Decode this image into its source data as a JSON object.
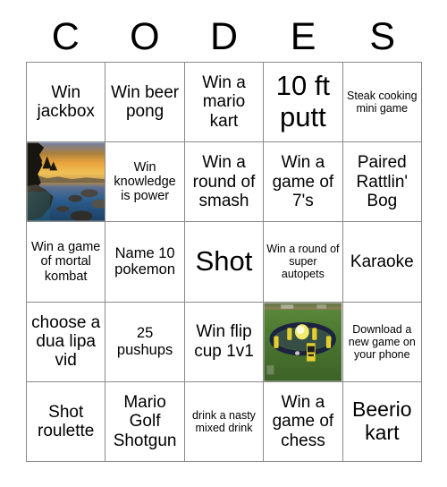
{
  "card": {
    "title_letters": [
      "C",
      "O",
      "D",
      "E",
      "S"
    ],
    "rows": [
      [
        {
          "type": "text",
          "text": "Win jackbox",
          "size": "l"
        },
        {
          "type": "text",
          "text": "Win beer pong",
          "size": "l"
        },
        {
          "type": "text",
          "text": "Win a mario kart",
          "size": "l"
        },
        {
          "type": "text",
          "text": "10 ft putt",
          "size": "xxl"
        },
        {
          "type": "text",
          "text": "Steak cooking mini game",
          "size": "xs"
        }
      ],
      [
        {
          "type": "image",
          "image": "sunset-lake-photo",
          "alt": "Sunset over a lake with rocks and silhouetted trees"
        },
        {
          "type": "text",
          "text": "Win knowledge is power",
          "size": "s"
        },
        {
          "type": "text",
          "text": "Win a round of smash",
          "size": "l"
        },
        {
          "type": "text",
          "text": "Win a game of 7's",
          "size": "l"
        },
        {
          "type": "text",
          "text": "Paired Rattlin' Bog",
          "size": "l"
        }
      ],
      [
        {
          "type": "text",
          "text": "Win a game of mortal kombat",
          "size": "s"
        },
        {
          "type": "text",
          "text": "Name 10 pokemon",
          "size": "m"
        },
        {
          "type": "text",
          "text": "Shot",
          "size": "xxl"
        },
        {
          "type": "text",
          "text": "Win a round of super autopets",
          "size": "xs"
        },
        {
          "type": "text",
          "text": "Karaoke",
          "size": "l"
        }
      ],
      [
        {
          "type": "text",
          "text": "choose a dua lipa vid",
          "size": "l"
        },
        {
          "type": "text",
          "text": "25 pushups",
          "size": "m"
        },
        {
          "type": "text",
          "text": "Win flip cup 1v1",
          "size": "l"
        },
        {
          "type": "image",
          "image": "spikeball-photo",
          "alt": "Spikeball roundnet set on green grass with a yellow ball"
        },
        {
          "type": "text",
          "text": "Download a new game on your phone",
          "size": "xs"
        }
      ],
      [
        {
          "type": "text",
          "text": "Shot roulette",
          "size": "l"
        },
        {
          "type": "text",
          "text": "Mario Golf Shotgun",
          "size": "l"
        },
        {
          "type": "text",
          "text": "drink a nasty mixed drink",
          "size": "xs"
        },
        {
          "type": "text",
          "text": "Win a game of chess",
          "size": "l"
        },
        {
          "type": "text",
          "text": "Beerio kart",
          "size": "xl"
        }
      ]
    ]
  },
  "colors": {
    "grid_line": "#8a8a8a",
    "background": "#ffffff",
    "text": "#000000",
    "sunset_sky": "#e8a33d",
    "sunset_water": "#2d5f8f",
    "grass_green": "#4e7a32",
    "spikeball_yellow": "#e8d23a"
  }
}
